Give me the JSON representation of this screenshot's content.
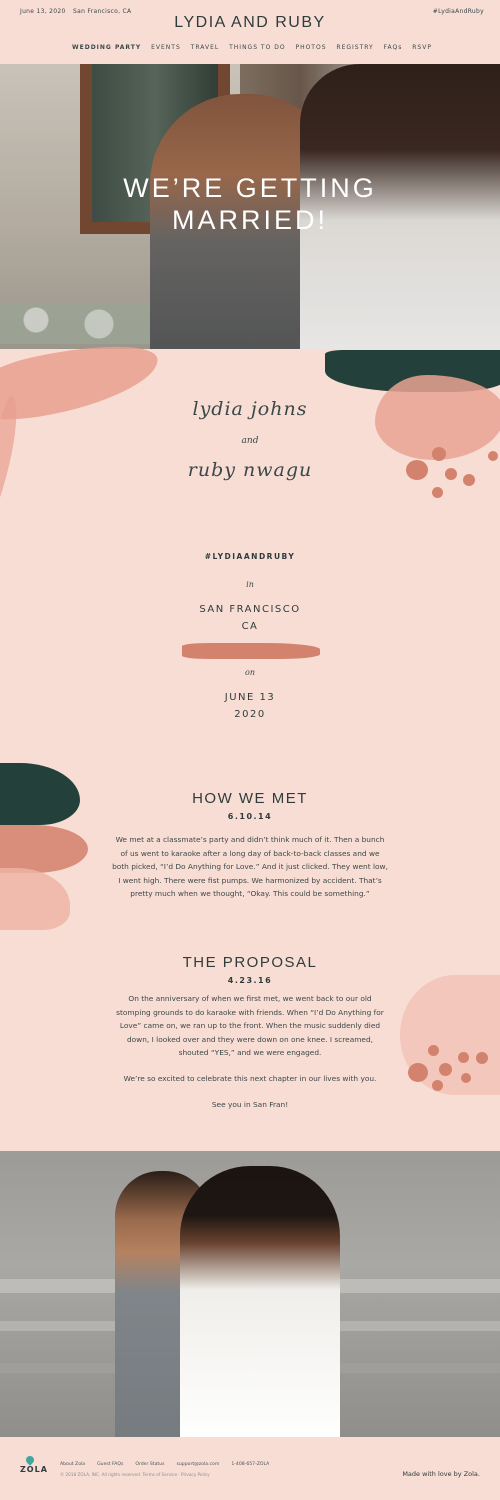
{
  "header": {
    "date": "June 13, 2020",
    "location": "San Francisco, CA",
    "title": "LYDIA AND RUBY",
    "hashtag": "#LydiaAndRuby",
    "nav": [
      {
        "label": "WEDDING PARTY",
        "active": true
      },
      {
        "label": "EVENTS"
      },
      {
        "label": "TRAVEL"
      },
      {
        "label": "THINGS TO DO"
      },
      {
        "label": "PHOTOS"
      },
      {
        "label": "REGISTRY"
      },
      {
        "label": "FAQs"
      },
      {
        "label": "RSVP"
      }
    ]
  },
  "hero": {
    "title_line1": "WE’RE GETTING",
    "title_line2": "MARRIED!"
  },
  "names": {
    "first": "lydia johns",
    "and": "and",
    "second": "ruby nwagu"
  },
  "details": {
    "hashtag": "#LYDIAANDRUBY",
    "in": "in",
    "city": "SAN FRANCISCO",
    "state": "CA",
    "on": "on",
    "date": "JUNE 13",
    "year": "2020"
  },
  "how_we_met": {
    "title": "HOW WE MET",
    "date": "6.10.14",
    "text": "We met at a classmate’s party and didn’t think much of it. Then a bunch of us went to karaoke after a long day of back-to-back classes and we both picked, “I’d Do Anything for Love.” And it just clicked. They went low, I went high. There were fist pumps. We harmonized by accident. That’s pretty much when we thought, “Okay. This could be something.”"
  },
  "proposal": {
    "title": "THE PROPOSAL",
    "date": "4.23.16",
    "text": "On the anniversary of when we first met, we went back to our old stomping grounds to do karaoke with friends. When “I’d Do Anything for Love” came on, we ran up to the front. When the music suddenly died down, I looked over and they were down on one knee. I screamed, shouted “YES,” and we were engaged.",
    "closing1": "We’re so excited to celebrate this next chapter in our lives with you.",
    "closing2": "See you in San Fran!"
  },
  "footer": {
    "logo": "ZOLA",
    "links": [
      "About Zola",
      "Guest FAQs",
      "Order Status",
      "support@zola.com",
      "1-408-657-ZOLA"
    ],
    "copyright": "© 2018 ZOLA, INC. All rights reserved.   Terms of Service  ·  Privacy Policy",
    "made_with": "Made with love by Zola."
  },
  "colors": {
    "background": "#f8ddd5",
    "accent_salmon": "#d3826d",
    "accent_teal": "#24403b",
    "text": "#2f3c3c"
  }
}
